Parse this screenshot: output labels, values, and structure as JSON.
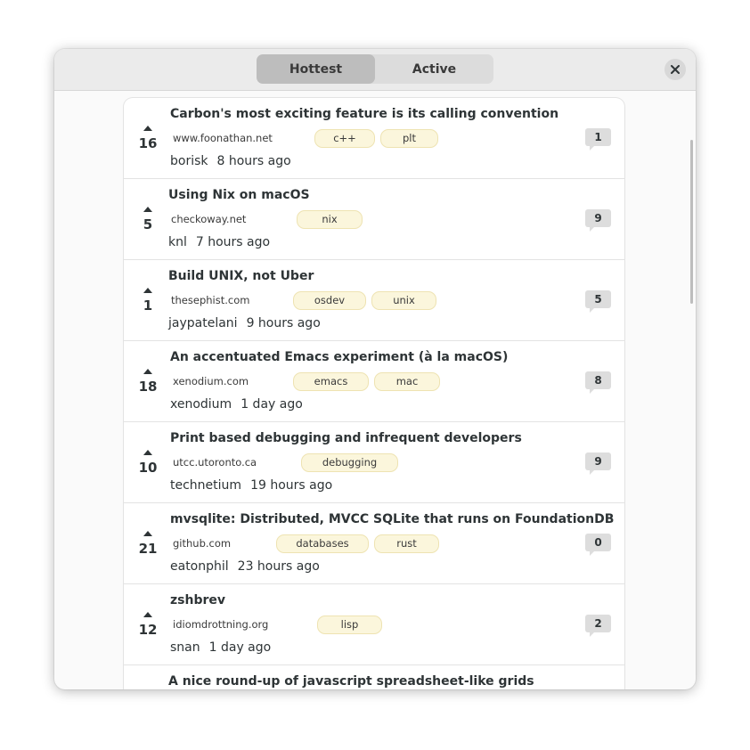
{
  "tabs": [
    {
      "label": "Hottest",
      "selected": true
    },
    {
      "label": "Active",
      "selected": false
    }
  ],
  "icons": {
    "close": "close-icon",
    "upvote": "upvote-arrow-icon",
    "comments": "comment-bubble-icon"
  },
  "colors": {
    "tag_bg": "#fbf6dc",
    "tag_border": "#eee3b2",
    "active_tab": "#bdbdbd"
  },
  "stories": [
    {
      "title": "Carbon's most exciting feature is its calling convention",
      "score": "16",
      "domain": "www.foonathan.net",
      "tags": [
        "c++",
        "plt"
      ],
      "author": "borisk",
      "time": "8 hours ago",
      "comments": "1"
    },
    {
      "title": "Using Nix on macOS",
      "score": "5",
      "domain": "checkoway.net",
      "tags": [
        "nix"
      ],
      "author": "knl",
      "time": "7 hours ago",
      "comments": "9"
    },
    {
      "title": "Build UNIX, not Uber",
      "score": "1",
      "domain": "thesephist.com",
      "tags": [
        "osdev",
        "unix"
      ],
      "author": "jaypatelani",
      "time": "9 hours ago",
      "comments": "5"
    },
    {
      "title": "An accentuated Emacs experiment (à la macOS)",
      "score": "18",
      "domain": "xenodium.com",
      "tags": [
        "emacs",
        "mac"
      ],
      "author": "xenodium",
      "time": "1 day ago",
      "comments": "8"
    },
    {
      "title": "Print based debugging and infrequent developers",
      "score": "10",
      "domain": "utcc.utoronto.ca",
      "tags": [
        "debugging"
      ],
      "author": "technetium",
      "time": "19 hours ago",
      "comments": "9"
    },
    {
      "title": "mvsqlite: Distributed, MVCC SQLite that runs on FoundationDB",
      "score": "21",
      "domain": "github.com",
      "tags": [
        "databases",
        "rust"
      ],
      "author": "eatonphil",
      "time": "23 hours ago",
      "comments": "0"
    },
    {
      "title": "zshbrev",
      "score": "12",
      "domain": "idiomdrottning.org",
      "tags": [
        "lisp"
      ],
      "author": "snan",
      "time": "1 day ago",
      "comments": "2"
    },
    {
      "title": "A nice round-up of javascript spreadsheet-like grids"
    }
  ]
}
